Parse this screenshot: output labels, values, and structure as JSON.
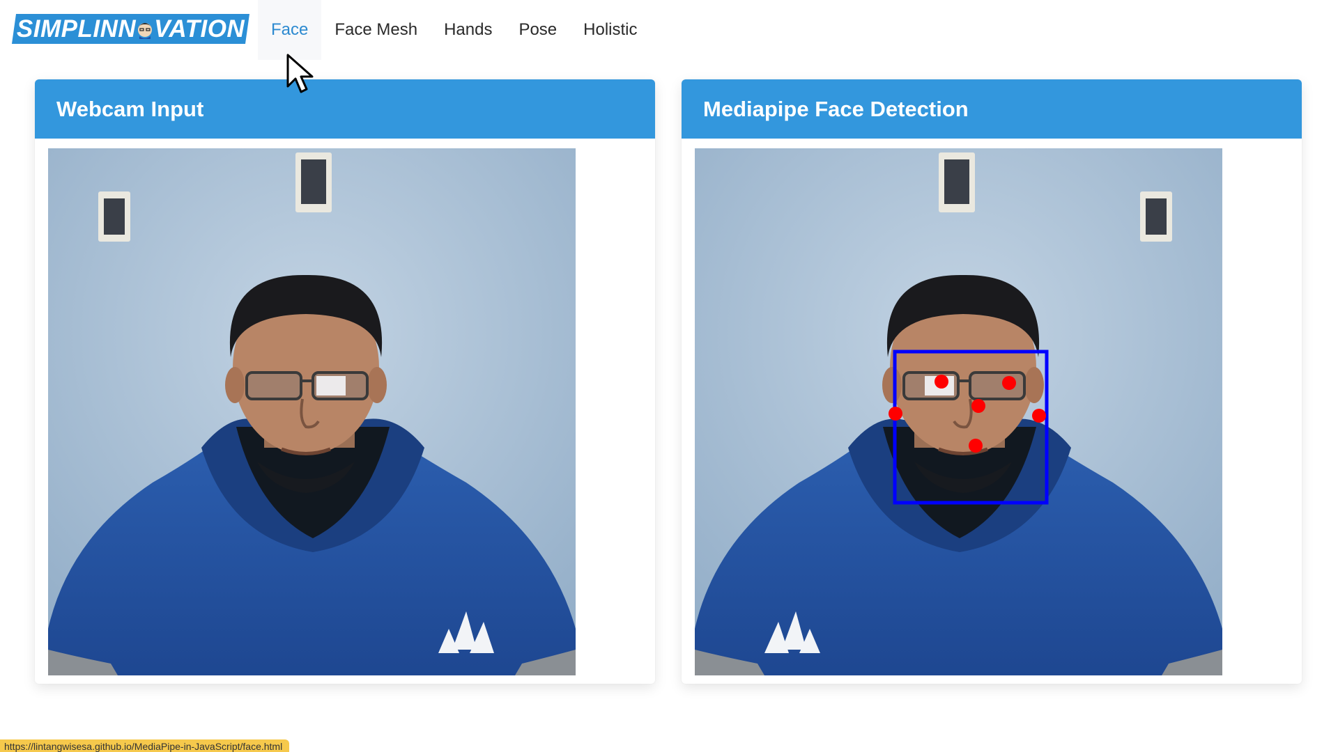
{
  "brand": {
    "text_pre": "SIMPLINN",
    "text_post": "VATION"
  },
  "nav": {
    "items": [
      {
        "label": "Face",
        "active": true
      },
      {
        "label": "Face Mesh",
        "active": false
      },
      {
        "label": "Hands",
        "active": false
      },
      {
        "label": "Pose",
        "active": false
      },
      {
        "label": "Holistic",
        "active": false
      }
    ]
  },
  "panels": {
    "input": {
      "title": "Webcam Input"
    },
    "output": {
      "title": "Mediapipe Face Detection"
    }
  },
  "status_bar": {
    "url": "https://lintangwisesa.github.io/MediaPipe-in-JavaScript/face.html"
  },
  "colors": {
    "accent": "#3397dd",
    "active_nav": "#2d8ad0",
    "detection_box": "#0000ff",
    "keypoints": "#ff0000",
    "status_bar": "#f6c94c"
  },
  "icons": [
    "cursor-arrow-icon",
    "brand-face-icon"
  ]
}
